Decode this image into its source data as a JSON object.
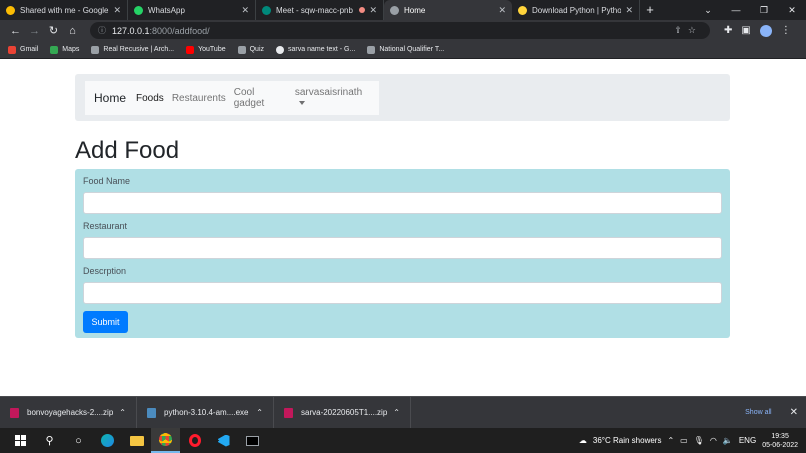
{
  "browser": {
    "tabs": [
      {
        "title": "Shared with me - Google Dri",
        "color": "#fbbc04"
      },
      {
        "title": "WhatsApp",
        "color": "#25d366"
      },
      {
        "title": "Meet - sqw-macc-pnb",
        "color": "#00897b",
        "recording": true
      },
      {
        "title": "Home",
        "color": "#9aa0a6",
        "active": true
      },
      {
        "title": "Download Python | Python.o",
        "color": "#ffd43b"
      }
    ],
    "new_tab_glyph": "+",
    "url_host": "127.0.0.1",
    "url_path": ":8000/addfood/",
    "bookmarks": [
      {
        "label": "Gmail",
        "color": "#ea4335"
      },
      {
        "label": "Maps",
        "color": "#34a853"
      },
      {
        "label": "Real Recusive | Arch...",
        "color": "#9aa0a6"
      },
      {
        "label": "YouTube",
        "color": "#ff0000"
      },
      {
        "label": "Quiz",
        "color": "#9aa0a6"
      },
      {
        "label": "sarva name text - G...",
        "color": "#e8eaed"
      },
      {
        "label": "National Qualifier T...",
        "color": "#9aa0a6"
      }
    ]
  },
  "navbar": {
    "brand": "Home",
    "links": [
      "Foods",
      "Restaurents",
      "Cool gadget"
    ],
    "dropdown_label": "sarvasaisrinath"
  },
  "page": {
    "heading": "Add Food",
    "fields": [
      {
        "label": "Food Name",
        "value": ""
      },
      {
        "label": "Restaurant",
        "value": ""
      },
      {
        "label": "Descrption",
        "value": ""
      }
    ],
    "submit_label": "Submit"
  },
  "downloads": {
    "items": [
      {
        "name": "bonvoyagehacks-2....zip",
        "type": "zip"
      },
      {
        "name": "python-3.10.4-am....exe",
        "type": "exe"
      },
      {
        "name": "sarva-20220605T1....zip",
        "type": "zip"
      }
    ],
    "show_all": "Show all"
  },
  "taskbar": {
    "weather": "36°C  Rain showers",
    "language": "ENG",
    "time": "19:35",
    "date": "05-06-2022"
  }
}
